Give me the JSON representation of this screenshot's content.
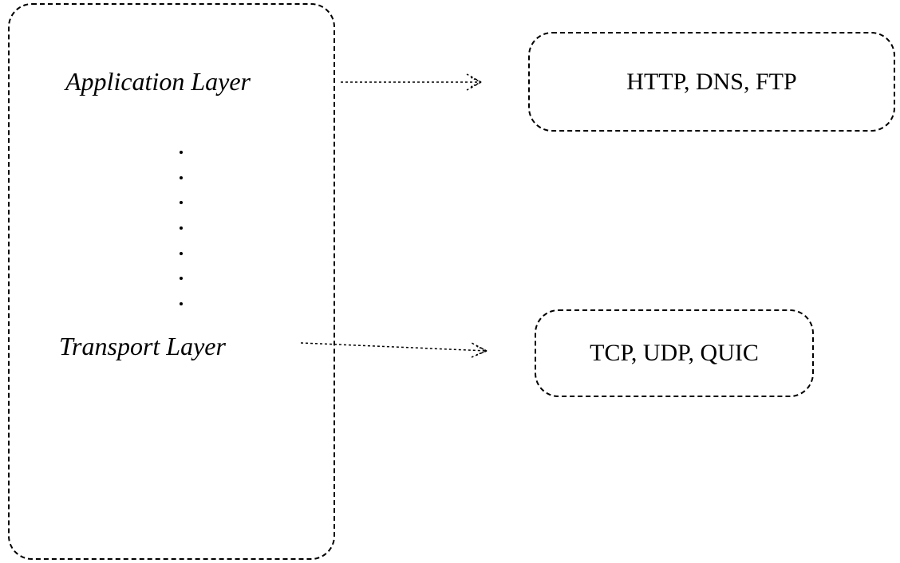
{
  "diagram": {
    "layers": {
      "application": {
        "label": "Application Layer",
        "protocols": "HTTP, DNS, FTP"
      },
      "transport": {
        "label": "Transport Layer",
        "protocols": "TCP, UDP, QUIC"
      }
    },
    "dot_count": 7
  }
}
